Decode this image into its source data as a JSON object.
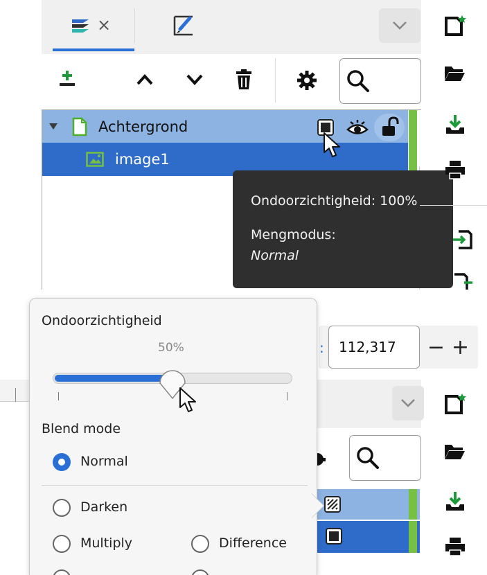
{
  "layers_panel": {
    "tabs": [
      {
        "icon": "layers-icon",
        "close_label": "×",
        "active": true
      },
      {
        "icon": "brush-icon",
        "active": false
      }
    ],
    "tree": {
      "group_name": "Achtergrond",
      "child_name": "image1"
    },
    "tooltip": {
      "opacity_line": "Ondoorzichtigheid: 100%",
      "blend_label": "Mengmodus:",
      "blend_value": "Normal"
    }
  },
  "tool_options": {
    "value_field": "112,317",
    "minus_label": "−",
    "plus_label": "+"
  },
  "popover": {
    "opacity_title": "Ondoorzichtigheid",
    "opacity_percent_label": "50%",
    "opacity_value_fraction": 0.5,
    "blend_title": "Blend mode",
    "options": {
      "normal": "Normal",
      "darken": "Darken",
      "multiply": "Multiply",
      "difference": "Difference"
    },
    "selected": "normal"
  },
  "colors": {
    "accent": "#2a6fd6",
    "row_group": "#8db3e2",
    "row_selected": "#2f6cc9",
    "green_indicator": "#76c043",
    "tooltip_bg": "#2f2f2f"
  }
}
